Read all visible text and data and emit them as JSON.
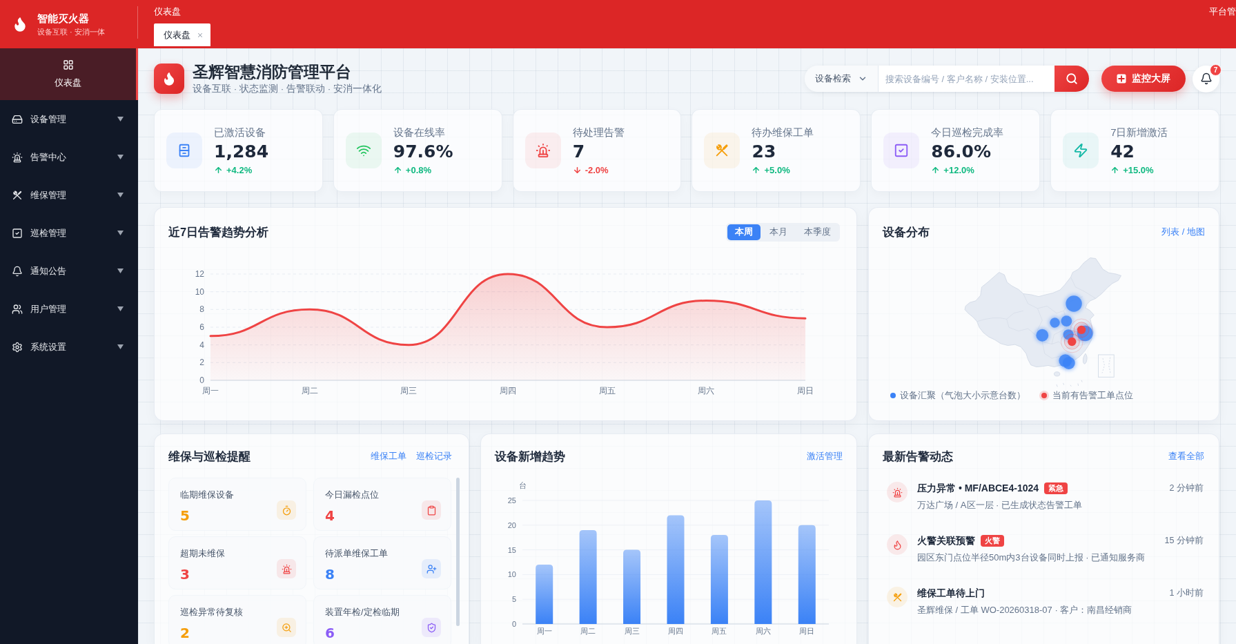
{
  "header": {
    "brand": {
      "title": "智能灭火器",
      "subtitle": "设备互联 · 安消一体"
    },
    "breadcrumb": "仪表盘",
    "tabs": [
      {
        "label": "仪表盘",
        "selected": true
      }
    ],
    "user_menu": "平台管"
  },
  "sidebar": {
    "items": [
      {
        "label": "仪表盘",
        "kind": "link",
        "selected": true
      },
      {
        "label": "设备管理",
        "kind": "group",
        "selected": false
      },
      {
        "label": "告警中心",
        "kind": "group",
        "selected": false
      },
      {
        "label": "维保管理",
        "kind": "group",
        "selected": false
      },
      {
        "label": "巡检管理",
        "kind": "group",
        "selected": false
      },
      {
        "label": "通知公告",
        "kind": "group",
        "selected": false
      },
      {
        "label": "用户管理",
        "kind": "group",
        "selected": false
      },
      {
        "label": "系统设置",
        "kind": "group",
        "selected": false
      }
    ]
  },
  "page_header": {
    "title": "圣辉智慧消防管理平台",
    "subtitle": "设备互联 · 状态监测 · 告警联动 · 安消一体化"
  },
  "search": {
    "scope": "设备检索",
    "placeholder": "搜索设备编号 / 客户名称 / 安装位置..."
  },
  "monitor_button": {
    "label": "监控大屏"
  },
  "notifications": {
    "badge": "7"
  },
  "stats": [
    {
      "label": "已激活设备",
      "value": "1,284",
      "change": "+4.2%",
      "rising": true,
      "color": "#3b82f6"
    },
    {
      "label": "设备在线率",
      "value": "97.6%",
      "change": "+0.8%",
      "rising": true,
      "color": "#22c55e"
    },
    {
      "label": "待处理告警",
      "value": "7",
      "change": "-2.0%",
      "rising": false,
      "color": "#ef4444"
    },
    {
      "label": "待办维保工单",
      "value": "23",
      "change": "+5.0%",
      "rising": true,
      "color": "#f59e0b"
    },
    {
      "label": "今日巡检完成率",
      "value": "86.0%",
      "change": "+12.0%",
      "rising": true,
      "color": "#8b5cf6"
    },
    {
      "label": "7日新增激活",
      "value": "42",
      "change": "+15.0%",
      "rising": true,
      "color": "#14b8a6"
    }
  ],
  "alert_trend": {
    "title": "近7日告警趋势分析",
    "periods": [
      {
        "label": "本周",
        "selected": true
      },
      {
        "label": "本月",
        "selected": false
      },
      {
        "label": "本季度",
        "selected": false
      }
    ],
    "chart_data": {
      "type": "area",
      "categories": [
        "周一",
        "周二",
        "周三",
        "周四",
        "周五",
        "周六",
        "周日"
      ],
      "series": [
        {
          "color": "#ef4444",
          "values": [
            5,
            8,
            4,
            12,
            6,
            9,
            7
          ]
        }
      ],
      "ylim": [
        0,
        12
      ],
      "yticks": [
        0,
        2,
        4,
        6,
        8,
        10,
        12
      ],
      "grid": true
    }
  },
  "distribution": {
    "title": "设备分布",
    "view_toggle": "列表 / 地图",
    "legend": [
      {
        "label": "设备汇聚（气泡大小示意台数）",
        "kind": "bubble",
        "color": "#3b82f6"
      },
      {
        "label": "当前有告警工单点位",
        "kind": "pulse",
        "color": "#ef4444"
      }
    ]
  },
  "reminders": {
    "title": "维保与巡检提醒",
    "links": [
      "维保工单",
      "巡检记录"
    ],
    "items": [
      {
        "label": "临期维保设备",
        "value": "5",
        "color": "#f59e0b"
      },
      {
        "label": "今日漏检点位",
        "value": "4",
        "color": "#ef4444"
      },
      {
        "label": "超期未维保",
        "value": "3",
        "color": "#ef4444"
      },
      {
        "label": "待派单维保工单",
        "value": "8",
        "color": "#3b82f6"
      },
      {
        "label": "巡检异常待复核",
        "value": "2",
        "color": "#f59e0b"
      },
      {
        "label": "装置年检/定检临期",
        "value": "6",
        "color": "#8b5cf6"
      }
    ]
  },
  "device_trend": {
    "title": "设备新增趋势",
    "link": "激活管理",
    "chart_data": {
      "type": "bar",
      "ylabel": "台",
      "categories": [
        "周一",
        "周二",
        "周三",
        "周四",
        "周五",
        "周六",
        "周日"
      ],
      "series": [
        {
          "color": "#3b82f6",
          "values": [
            12,
            19,
            15,
            22,
            18,
            25,
            20
          ]
        }
      ],
      "ylim": [
        0,
        25
      ],
      "yticks": [
        0,
        5,
        10,
        15,
        20,
        25
      ],
      "grid": true
    }
  },
  "alerts": {
    "title": "最新告警动态",
    "link": "查看全部",
    "items": [
      {
        "title": "压力异常 • MF/ABCE4-1024",
        "badge": "紧急",
        "time": "2 分钟前",
        "detail": "万达广场 / A区一层 · 已生成状态告警工单",
        "color": "#ef4444"
      },
      {
        "title": "火警关联预警",
        "badge": "火警",
        "time": "15 分钟前",
        "detail": "园区东门点位半径50m内3台设备同时上报 · 已通知服务商",
        "color": "#ef4444"
      },
      {
        "title": "维保工单待上门",
        "time": "1 小时前",
        "detail": "圣辉维保 / 工单 WO-20260318-07 · 客户：南昌经销商",
        "color": "#f59e0b"
      }
    ]
  }
}
